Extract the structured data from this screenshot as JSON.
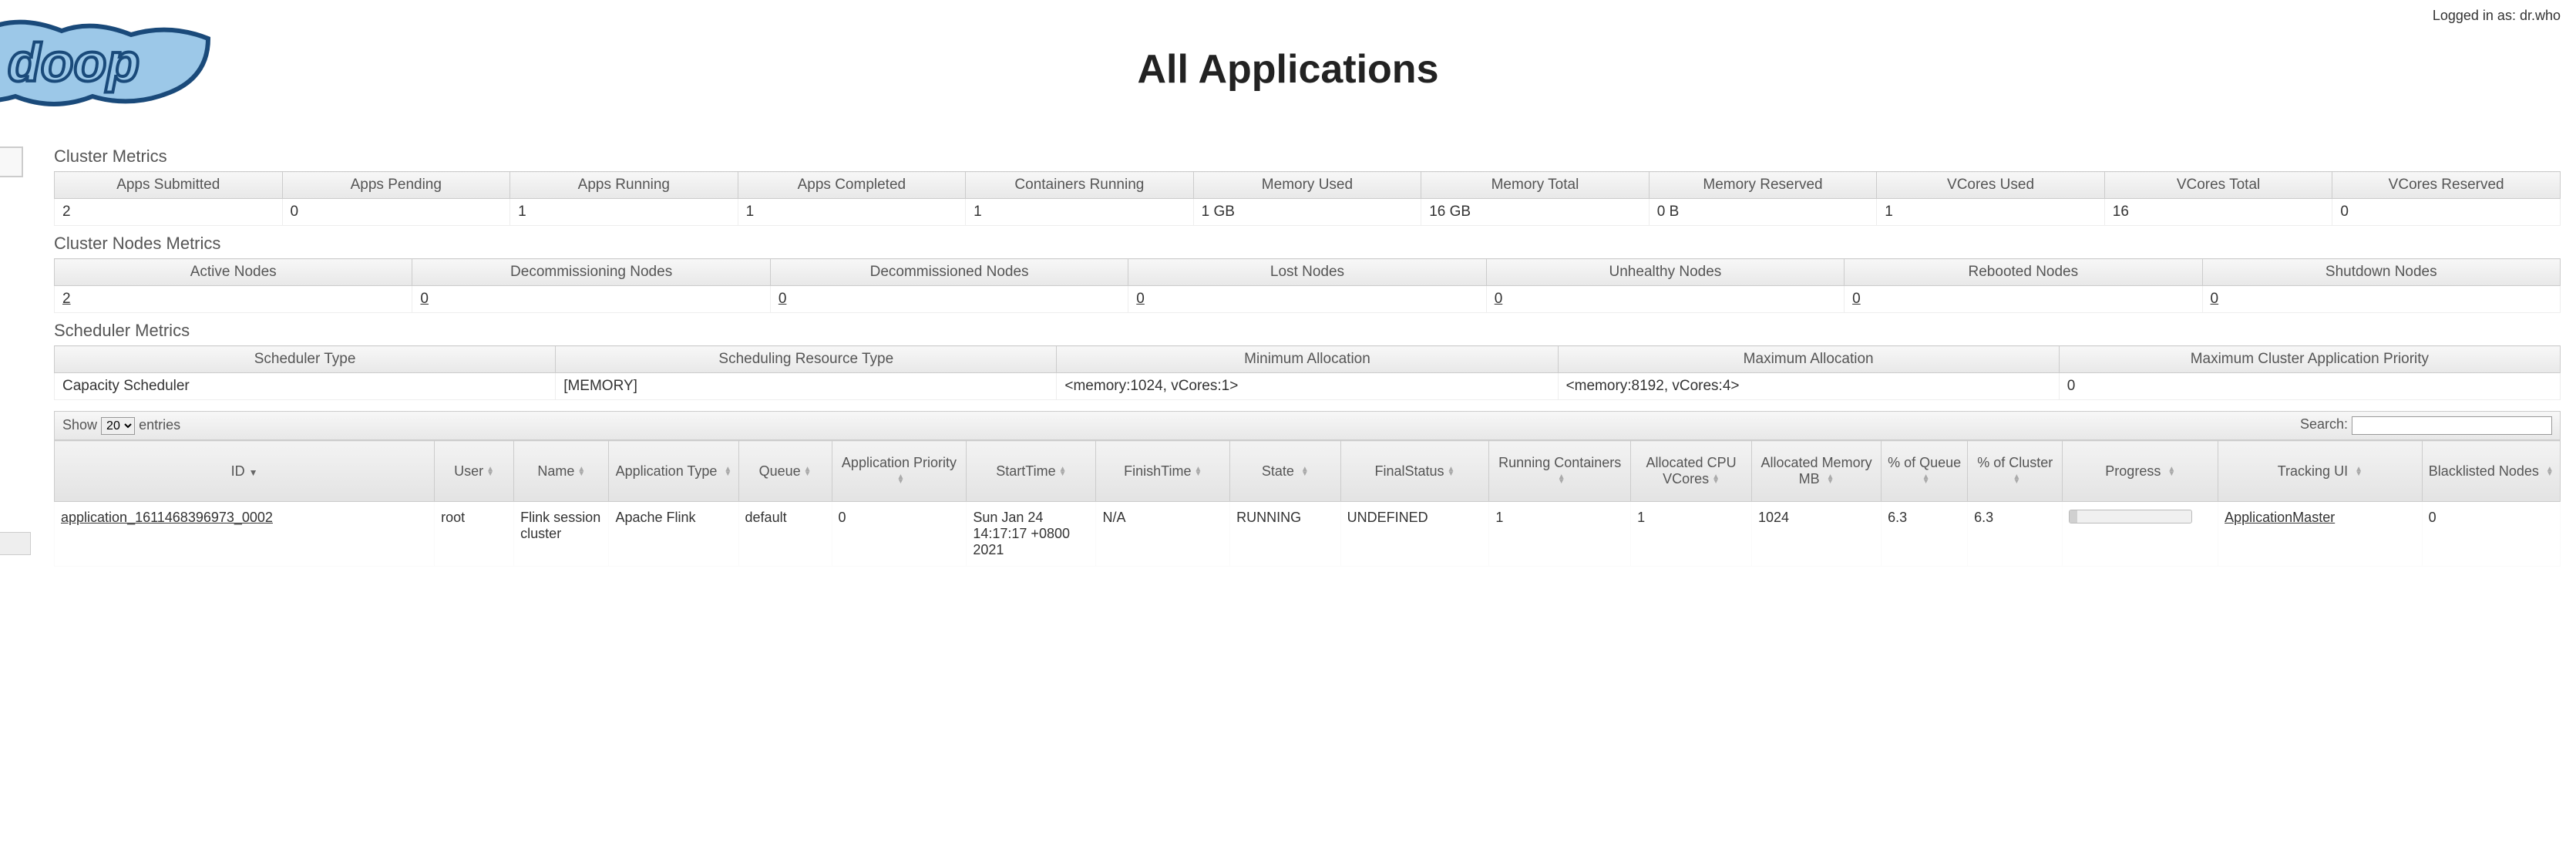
{
  "header": {
    "title": "All Applications",
    "logged_in_prefix": "Logged in as: ",
    "logged_in_user": "dr.who"
  },
  "cluster_metrics": {
    "title": "Cluster Metrics",
    "headers": [
      "Apps Submitted",
      "Apps Pending",
      "Apps Running",
      "Apps Completed",
      "Containers Running",
      "Memory Used",
      "Memory Total",
      "Memory Reserved",
      "VCores Used",
      "VCores Total",
      "VCores Reserved"
    ],
    "row": [
      "2",
      "0",
      "1",
      "1",
      "1",
      "1 GB",
      "16 GB",
      "0 B",
      "1",
      "16",
      "0"
    ]
  },
  "nodes_metrics": {
    "title": "Cluster Nodes Metrics",
    "headers": [
      "Active Nodes",
      "Decommissioning Nodes",
      "Decommissioned Nodes",
      "Lost Nodes",
      "Unhealthy Nodes",
      "Rebooted Nodes",
      "Shutdown Nodes"
    ],
    "row": [
      "2",
      "0",
      "0",
      "0",
      "0",
      "0",
      "0"
    ]
  },
  "scheduler_metrics": {
    "title": "Scheduler Metrics",
    "headers": [
      "Scheduler Type",
      "Scheduling Resource Type",
      "Minimum Allocation",
      "Maximum Allocation",
      "Maximum Cluster Application Priority"
    ],
    "row": [
      "Capacity Scheduler",
      "[MEMORY]",
      "<memory:1024, vCores:1>",
      "<memory:8192, vCores:4>",
      "0"
    ]
  },
  "datatable": {
    "show_label_a": "Show",
    "show_value": "20",
    "show_label_b": "entries",
    "search_label": "Search:",
    "headers": {
      "id": "ID",
      "user": "User",
      "name": "Name",
      "apptype": "Application Type",
      "queue": "Queue",
      "priority": "Application Priority",
      "start": "StartTime",
      "finish": "FinishTime",
      "state": "State",
      "final": "FinalStatus",
      "running": "Running Containers",
      "cpu": "Allocated CPU VCores",
      "mem": "Allocated Memory MB",
      "pq": "% of Queue",
      "pc": "% of Cluster",
      "progress": "Progress",
      "tracking": "Tracking UI",
      "blacklisted": "Blacklisted Nodes"
    },
    "rows": [
      {
        "id": "application_1611468396973_0002",
        "user": "root",
        "name": "Flink session cluster",
        "apptype": "Apache Flink",
        "queue": "default",
        "priority": "0",
        "start": "Sun Jan 24 14:17:17 +0800 2021",
        "finish": "N/A",
        "state": "RUNNING",
        "final": "UNDEFINED",
        "running": "1",
        "cpu": "1",
        "mem": "1024",
        "pq": "6.3",
        "pc": "6.3",
        "tracking": "ApplicationMaster",
        "blacklisted": "0"
      }
    ]
  }
}
